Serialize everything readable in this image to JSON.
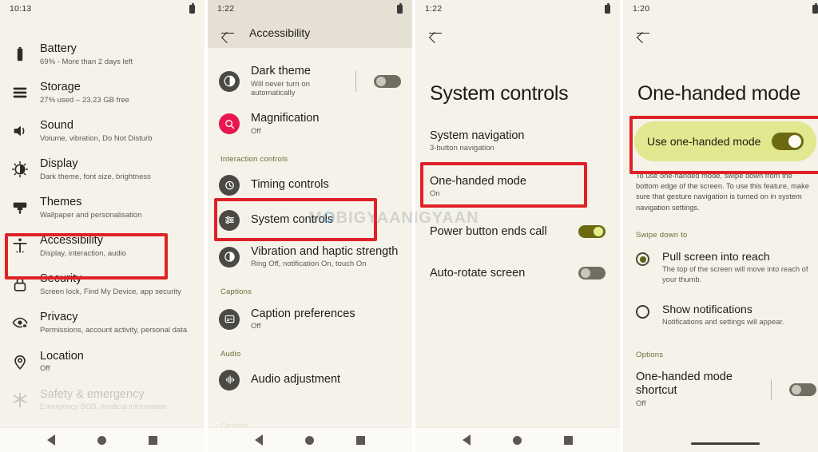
{
  "colors": {
    "page_bg": "#f5f2ea",
    "appbar_tint": "#e5e0d3",
    "accent_highlight": "#e2e890",
    "toggle_on": "#6c6a11",
    "toggle_off": "#706e63",
    "annotation_red": "#e02127",
    "section_label": "#6d6b36",
    "magnification_pink": "#e8174e"
  },
  "watermark": {
    "prefix": "M",
    "circle": "O",
    "suffix": "BIGYAAN"
  },
  "panels": [
    {
      "id": "settings-main",
      "status": {
        "time": "10:13",
        "battery_icon": "battery-icon"
      },
      "appbar": null,
      "items": [
        {
          "icon": "battery-icon",
          "title": "Battery",
          "sub": "69% - More than 2 days left"
        },
        {
          "icon": "storage-icon",
          "title": "Storage",
          "sub": "27% used – 23.23 GB free"
        },
        {
          "icon": "sound-icon",
          "title": "Sound",
          "sub": "Volume, vibration, Do Not Disturb"
        },
        {
          "icon": "display-icon",
          "title": "Display",
          "sub": "Dark theme, font size, brightness"
        },
        {
          "icon": "themes-icon",
          "title": "Themes",
          "sub": "Wallpaper and personalisation"
        },
        {
          "icon": "accessibility-icon",
          "title": "Accessibility",
          "sub": "Display, interaction, audio"
        },
        {
          "icon": "security-lock-icon",
          "title": "Security",
          "sub": "Screen lock, Find My Device, app security"
        },
        {
          "icon": "privacy-eye-icon",
          "title": "Privacy",
          "sub": "Permissions, account activity, personal data"
        },
        {
          "icon": "location-pin-icon",
          "title": "Location",
          "sub": "Off"
        },
        {
          "icon": "safety-emergency-icon",
          "title": "Safety & emergency",
          "sub": "Emergency SOS, medical information"
        }
      ],
      "nav": {
        "back": "nav-back-icon",
        "home": "nav-home-icon",
        "recents": "nav-recents-icon"
      }
    },
    {
      "id": "accessibility",
      "status": {
        "time": "1:22",
        "battery_icon": "battery-icon"
      },
      "appbar": {
        "back": "back-arrow-icon",
        "title": "Accessibility"
      },
      "rows": [
        {
          "icon": "dark-theme-icon",
          "title": "Dark theme",
          "sub": "Will never turn on automatically",
          "toggle": "off"
        },
        {
          "icon": "magnification-icon",
          "title": "Magnification",
          "sub": "Off",
          "toggle": null
        }
      ],
      "sections": [
        {
          "label": "Interaction controls",
          "rows": [
            {
              "icon": "timing-controls-icon",
              "title": "Timing controls",
              "sub": ""
            },
            {
              "icon": "system-controls-icon",
              "title": "System controls",
              "sub": ""
            },
            {
              "icon": "vibration-icon",
              "title": "Vibration and haptic strength",
              "sub": "Ring Off, notification On, touch On"
            }
          ]
        },
        {
          "label": "Captions",
          "rows": [
            {
              "icon": "caption-icon",
              "title": "Caption preferences",
              "sub": "Off"
            }
          ]
        },
        {
          "label": "Audio",
          "rows": [
            {
              "icon": "audio-adjustment-icon",
              "title": "Audio adjustment",
              "sub": ""
            }
          ]
        },
        {
          "label": "General",
          "rows": []
        }
      ],
      "nav": {
        "back": "nav-back-icon",
        "home": "nav-home-icon",
        "recents": "nav-recents-icon"
      }
    },
    {
      "id": "system-controls",
      "status": {
        "time": "1:22",
        "battery_icon": "battery-icon"
      },
      "appbar": {
        "back": "back-arrow-icon",
        "title": ""
      },
      "page_title": "System controls",
      "rows": [
        {
          "title": "System navigation",
          "sub": "3-button navigation",
          "toggle": null
        },
        {
          "title": "One-handed mode",
          "sub": "On",
          "toggle": null
        },
        {
          "title": "Power button ends call",
          "sub": "",
          "toggle": "on"
        },
        {
          "title": "Auto-rotate screen",
          "sub": "",
          "toggle": "off"
        }
      ],
      "nav": {
        "back": "nav-back-icon",
        "home": "nav-home-icon",
        "recents": "nav-recents-icon"
      }
    },
    {
      "id": "one-handed-mode",
      "status": {
        "time": "1:20",
        "battery_icon": "battery-icon"
      },
      "appbar": {
        "back": "back-arrow-icon",
        "title": ""
      },
      "page_title": "One-handed mode",
      "highlight": {
        "label": "Use one-handed mode",
        "toggle": "on"
      },
      "description": "To use one-handed mode, swipe down from the bottom edge of the screen. To use this feature, make sure that gesture navigation is turned on in system navigation settings.",
      "swipe_section": "Swipe down to",
      "radios": [
        {
          "title": "Pull screen into reach",
          "sub": "The top of the screen will move into reach of your thumb.",
          "state": "checked"
        },
        {
          "title": "Show notifications",
          "sub": "Notifications and settings will appear.",
          "state": "unchecked"
        }
      ],
      "options_section": "Options",
      "option_row": {
        "title": "One-handed mode shortcut",
        "sub": "Off",
        "toggle": "off"
      }
    }
  ]
}
